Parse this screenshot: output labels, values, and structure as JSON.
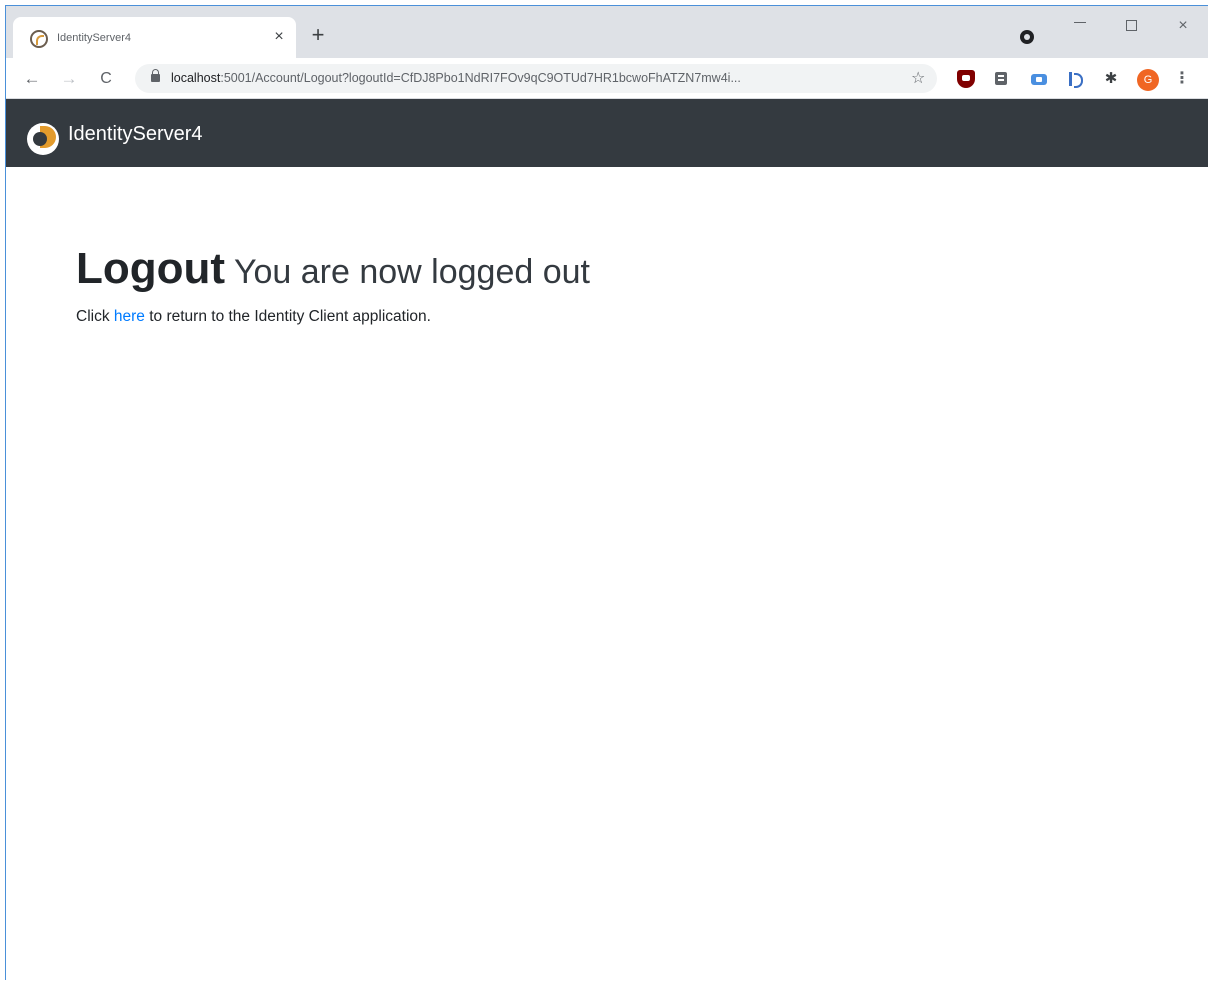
{
  "browser": {
    "tab": {
      "title": "IdentityServer4",
      "close_glyph": "×"
    },
    "new_tab_glyph": "+",
    "window_controls": {
      "close_glyph": "×"
    },
    "nav": {
      "back_glyph": "←",
      "forward_glyph": "→",
      "reload_glyph": "C"
    },
    "address_bar": {
      "host": "localhost",
      "rest": ":5001/Account/Logout?logoutId=CfDJ8Pbo1NdRI7FOv9qC9OTUd7HR1bcwoFhATZN7mw4i...",
      "star_glyph": "☆"
    },
    "extensions": [
      "ublock-icon",
      "notes-icon",
      "tag-icon",
      "bookmark-icon",
      "puzzle-icon"
    ],
    "avatar_letter": "G",
    "menu_glyph": "⋮",
    "colors": {
      "accent_border": "#4a90d9",
      "avatar": "#f06623"
    }
  },
  "app": {
    "navbar": {
      "brand": "IdentityServer4",
      "background": "#343a40"
    },
    "logout": {
      "title": "Logout",
      "subtitle": "You are now logged out",
      "text_before": "Click ",
      "link": "here",
      "text_after": " to return to the Identity Client application.",
      "link_color": "#007bff"
    }
  }
}
